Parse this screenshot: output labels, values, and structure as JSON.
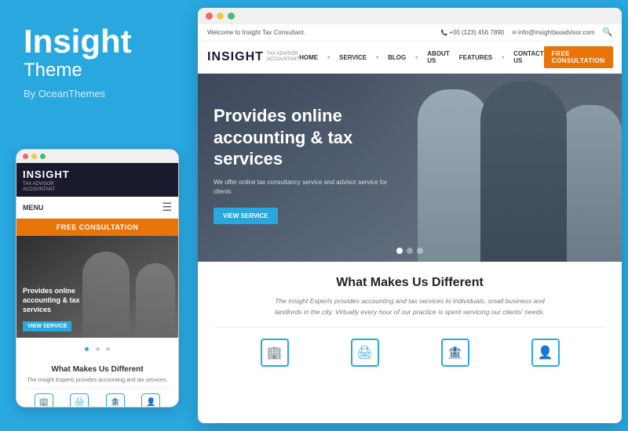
{
  "left": {
    "title": "Insight",
    "subtitle": "Theme",
    "by": "By OceanThemes"
  },
  "mobile": {
    "logo": "INSIGHT",
    "logo_sub1": "TAX ADVISOR",
    "logo_sub2": "ACCOUNTANT",
    "menu_label": "MENU",
    "cta_btn": "FREE CONSULTATION",
    "hero_title": "Provides online accounting & tax services",
    "view_btn": "VIEW SERVICE",
    "bottom_title": "What Makes Us Different",
    "bottom_text": "The Insight Experts provides accounting and tax services."
  },
  "desktop": {
    "topbar": {
      "welcome": "Welcome to Insight Tax Consultant.",
      "phone": "+00 (123) 456 7890",
      "email": "info@insighttaxadvisor.com"
    },
    "logo": "INSIGHT",
    "logo_sub1": "TAX ADVISOR",
    "logo_sub2": "ACCOUNTANT",
    "nav": {
      "home": "HOME",
      "service": "SERVICE",
      "blog": "BLOG",
      "about_us": "ABOUT US",
      "features": "FEATURES",
      "contact": "CONTACT US"
    },
    "cta_btn": "FREE CONSULTATION",
    "hero": {
      "title": "Provides online accounting & tax services",
      "desc": "We offer online tax consultancy service and advisor service for clients",
      "btn": "VIEW SERVICE"
    },
    "section": {
      "title": "What Makes Us Different",
      "desc": "The Insight Experts provides accounting and tax services to individuals, small business and landlords in the city. Virtually every hour of our practice is spent servicing our clients' needs."
    },
    "icons": [
      "🏢",
      "🖨️",
      "🏦",
      "👤"
    ]
  }
}
